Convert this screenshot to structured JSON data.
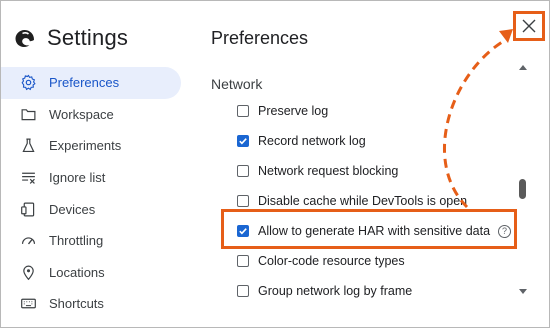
{
  "app": {
    "title": "Settings"
  },
  "sidebar": {
    "items": [
      {
        "label": "Preferences",
        "icon": "gear-icon",
        "active": true
      },
      {
        "label": "Workspace",
        "icon": "folder-icon",
        "active": false
      },
      {
        "label": "Experiments",
        "icon": "flask-icon",
        "active": false
      },
      {
        "label": "Ignore list",
        "icon": "ignore-list-icon",
        "active": false
      },
      {
        "label": "Devices",
        "icon": "devices-icon",
        "active": false
      },
      {
        "label": "Throttling",
        "icon": "speedometer-icon",
        "active": false
      },
      {
        "label": "Locations",
        "icon": "location-pin-icon",
        "active": false
      },
      {
        "label": "Shortcuts",
        "icon": "keyboard-icon",
        "active": false
      }
    ]
  },
  "main": {
    "panel_title": "Preferences",
    "section_title": "Network",
    "options": [
      {
        "label": "Preserve log",
        "checked": false
      },
      {
        "label": "Record network log",
        "checked": true
      },
      {
        "label": "Network request blocking",
        "checked": false
      },
      {
        "label": "Disable cache while DevTools is open",
        "checked": false
      },
      {
        "label": "Allow to generate HAR with sensitive data",
        "checked": true,
        "help": "?"
      },
      {
        "label": "Color-code resource types",
        "checked": false
      },
      {
        "label": "Group network log by frame",
        "checked": false
      }
    ]
  },
  "colors": {
    "accent": "#1a66d2",
    "active_bg": "#e8eefc",
    "annotation": "#e65e18"
  }
}
